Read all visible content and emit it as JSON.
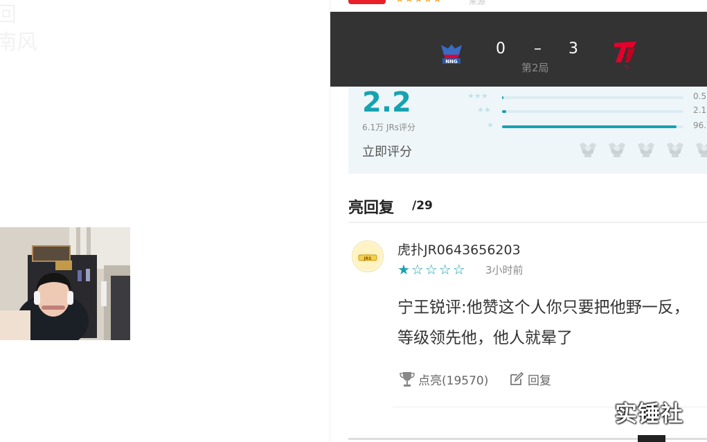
{
  "left": {
    "ghost_text": "回\n南风"
  },
  "top": {
    "faded_text": "来源"
  },
  "match": {
    "team_left": {
      "name": "NNG",
      "color": "#2a5aa8"
    },
    "score_left": "0",
    "separator": "–",
    "score_right": "3",
    "team_right": {
      "name": "T1",
      "color": "#e4002b"
    },
    "game_label": "第2局"
  },
  "rating": {
    "score": "2.2",
    "rater_count": "6.1万 JRs评分",
    "rate_now_label": "立即评分",
    "accent_color": "#17a2b0",
    "distribution": [
      {
        "stars": 3,
        "percent": 0.5,
        "label": "0.5"
      },
      {
        "stars": 2,
        "percent": 2.1,
        "label": "2.1"
      },
      {
        "stars": 1,
        "percent": 96.0,
        "label": "96."
      }
    ],
    "trophy_icon_count": 5
  },
  "highlight_replies": {
    "title": "亮回复",
    "count": "/29"
  },
  "reply": {
    "username": "虎扑JR0643656203",
    "star_rating": 1,
    "star_max": 5,
    "time": "3小时前",
    "body_line1": "宁王锐评:他赞这个人你只要把他野一反，",
    "body_line2": "等级领先他，他人就晕了",
    "like_label": "点亮(19570)",
    "reply_label": "回复"
  },
  "watermark": "实锤社"
}
